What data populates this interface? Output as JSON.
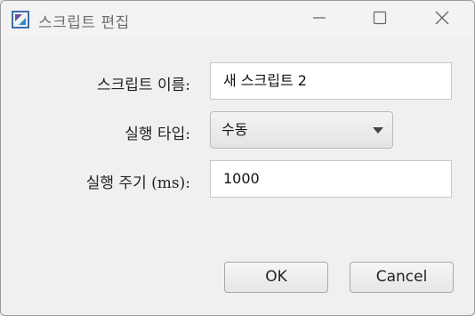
{
  "window": {
    "title": "스크립트 편집"
  },
  "form": {
    "name_label": "스크립트 이름:",
    "name_value": "새 스크립트 2",
    "type_label": "실행 타입:",
    "type_value": "수동",
    "period_label": "실행 주기 (ms):",
    "period_value": "1000"
  },
  "buttons": {
    "ok": "OK",
    "cancel": "Cancel"
  },
  "icons": {
    "app": "app-icon",
    "minimize": "minimize-icon",
    "maximize": "maximize-icon",
    "close": "close-icon",
    "dropdown": "chevron-down-icon"
  }
}
